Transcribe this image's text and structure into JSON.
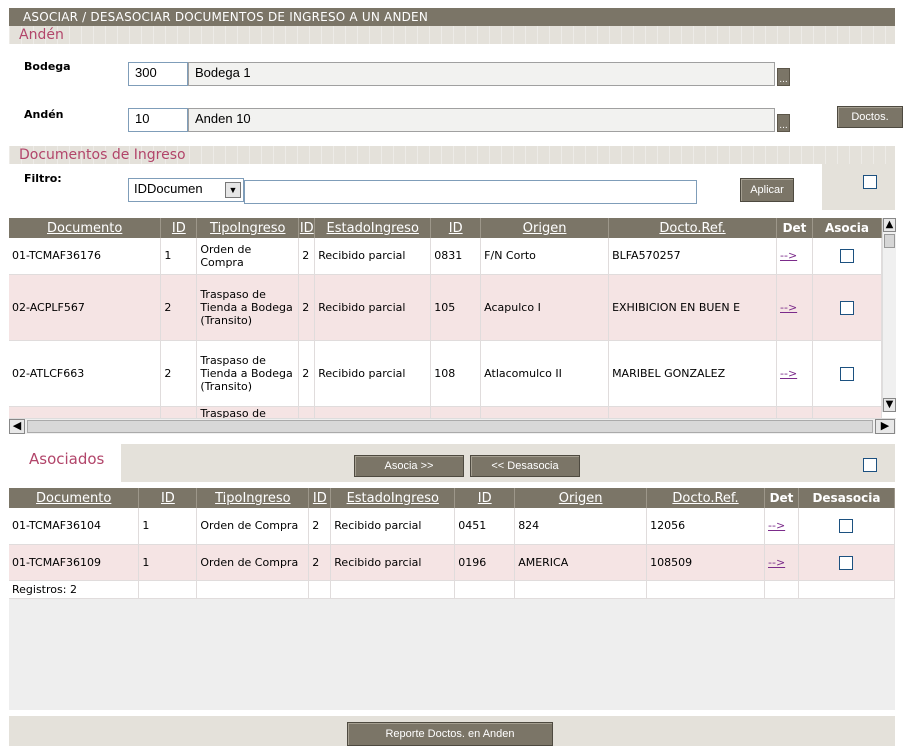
{
  "window": {
    "title": "ASOCIAR / DESASOCIAR DOCUMENTOS DE INGRESO A UN ANDEN"
  },
  "anden_section": {
    "title": "Andén",
    "bodega_label": "Bodega",
    "bodega_code": "300",
    "bodega_name": "Bodega 1",
    "anden_label": "Andén",
    "anden_code": "10",
    "anden_name": "Anden 10",
    "doctos_button": "Doctos.",
    "lookup_label": "..."
  },
  "docs_section": {
    "title": "Documentos de Ingreso",
    "filtro_label": "Filtro:",
    "filter_select": "IDDocumen",
    "filter_value": "",
    "apply_button": "Aplicar"
  },
  "docs_table": {
    "headers": [
      "Documento",
      "ID",
      "TipoIngreso",
      "ID",
      "EstadoIngreso",
      "ID",
      "Origen",
      "Docto.Ref.",
      "Det",
      "Asocia"
    ],
    "rows": [
      [
        "01-TCMAF36176",
        "1",
        "Orden de Compra",
        "2",
        "Recibido parcial",
        "0831",
        "F/N Corto",
        "BLFA570257",
        "-->"
      ],
      [
        "02-ACPLF567",
        "2",
        "Traspaso de Tienda a Bodega (Transito)",
        "2",
        "Recibido parcial",
        "105",
        "Acapulco I",
        "EXHIBICION EN BUEN E",
        "-->"
      ],
      [
        "02-ATLCF663",
        "2",
        "Traspaso de Tienda a Bodega (Transito)",
        "2",
        "Recibido parcial",
        "108",
        "Atlacomulco II",
        "MARIBEL GONZALEZ",
        "-->"
      ]
    ],
    "partial_row": "Traspaso de"
  },
  "asociados_section": {
    "title": "Asociados",
    "asocia_button": "Asocia >>",
    "desasocia_button": "<< Desasocia"
  },
  "assoc_table": {
    "headers": [
      "Documento",
      "ID",
      "TipoIngreso",
      "ID",
      "EstadoIngreso",
      "ID",
      "Origen",
      "Docto.Ref.",
      "Det",
      "Desasocia"
    ],
    "rows": [
      [
        "01-TCMAF36104",
        "1",
        "Orden de Compra",
        "2",
        "Recibido parcial",
        "0451",
        "824",
        "12056",
        "-->"
      ],
      [
        "01-TCMAF36109",
        "1",
        "Orden de Compra",
        "2",
        "Recibido parcial",
        "0196",
        "AMERICA",
        "108509",
        "-->"
      ]
    ],
    "registros": "Registros: 2"
  },
  "footer": {
    "report_button": "Reporte Doctos. en Anden"
  },
  "colors": {
    "header": "#7b7567",
    "section_text": "#b2456a",
    "pink_row": "#f5e4e4"
  }
}
